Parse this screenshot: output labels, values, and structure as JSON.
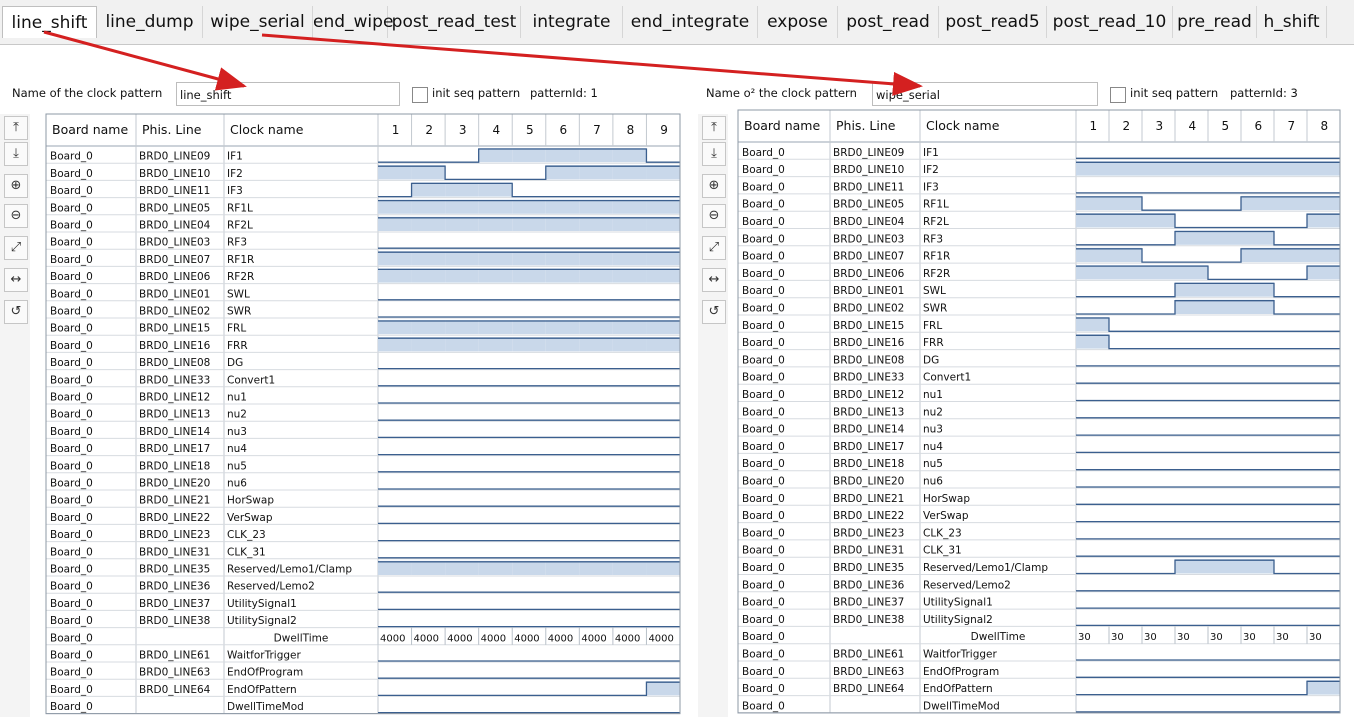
{
  "tabs": [
    "line_shift",
    "line_dump",
    "wipe_serial",
    "end_wipe",
    "post_read_test",
    "integrate",
    "end_integrate",
    "expose",
    "post_read",
    "post_read5",
    "post_read_10",
    "pre_read",
    "h_shift"
  ],
  "active_tab": "line_shift",
  "colors": {
    "high": "#c9d8ea",
    "edge": "#3b5f8e",
    "arrow": "#d42020",
    "grid": "#9aa6b3"
  },
  "toolbar_icons": [
    "add-row-icon",
    "remove-row-icon",
    "zoom-in-icon",
    "zoom-out-icon",
    "zoom-fit-icon",
    "zoom-width-icon",
    "zoom-reset-icon"
  ],
  "left_panel": {
    "name_label": "Name of the clock pattern",
    "name_value": "line_shift",
    "init_label": "init seq pattern",
    "pattern_id": "patternId: 1",
    "headers": [
      "Board name",
      "Phis. Line",
      "Clock name"
    ],
    "columns": [
      "1",
      "2",
      "3",
      "4",
      "5",
      "6",
      "7",
      "8",
      "9"
    ],
    "dwell_values": [
      "4000",
      "4000",
      "4000",
      "4000",
      "4000",
      "4000",
      "4000",
      "4000",
      "4000"
    ],
    "rows": [
      {
        "board": "Board_0",
        "line": "BRD0_LINE09",
        "clock": "IF1",
        "wave": [
          0,
          0,
          0,
          1,
          1,
          1,
          1,
          1,
          0
        ]
      },
      {
        "board": "Board_0",
        "line": "BRD0_LINE10",
        "clock": "IF2",
        "wave": [
          1,
          1,
          0,
          0,
          0,
          1,
          1,
          1,
          1
        ]
      },
      {
        "board": "Board_0",
        "line": "BRD0_LINE11",
        "clock": "IF3",
        "wave": [
          0,
          1,
          1,
          1,
          0,
          0,
          0,
          0,
          0
        ]
      },
      {
        "board": "Board_0",
        "line": "BRD0_LINE05",
        "clock": "RF1L",
        "wave": [
          1,
          1,
          1,
          1,
          1,
          1,
          1,
          1,
          1
        ]
      },
      {
        "board": "Board_0",
        "line": "BRD0_LINE04",
        "clock": "RF2L",
        "wave": [
          1,
          1,
          1,
          1,
          1,
          1,
          1,
          1,
          1
        ]
      },
      {
        "board": "Board_0",
        "line": "BRD0_LINE03",
        "clock": "RF3",
        "wave": [
          0,
          0,
          0,
          0,
          0,
          0,
          0,
          0,
          0
        ]
      },
      {
        "board": "Board_0",
        "line": "BRD0_LINE07",
        "clock": "RF1R",
        "wave": [
          1,
          1,
          1,
          1,
          1,
          1,
          1,
          1,
          1
        ]
      },
      {
        "board": "Board_0",
        "line": "BRD0_LINE06",
        "clock": "RF2R",
        "wave": [
          1,
          1,
          1,
          1,
          1,
          1,
          1,
          1,
          1
        ]
      },
      {
        "board": "Board_0",
        "line": "BRD0_LINE01",
        "clock": "SWL",
        "wave": [
          0,
          0,
          0,
          0,
          0,
          0,
          0,
          0,
          0
        ]
      },
      {
        "board": "Board_0",
        "line": "BRD0_LINE02",
        "clock": "SWR",
        "wave": [
          0,
          0,
          0,
          0,
          0,
          0,
          0,
          0,
          0
        ]
      },
      {
        "board": "Board_0",
        "line": "BRD0_LINE15",
        "clock": "FRL",
        "wave": [
          1,
          1,
          1,
          1,
          1,
          1,
          1,
          1,
          1
        ]
      },
      {
        "board": "Board_0",
        "line": "BRD0_LINE16",
        "clock": "FRR",
        "wave": [
          1,
          1,
          1,
          1,
          1,
          1,
          1,
          1,
          1
        ]
      },
      {
        "board": "Board_0",
        "line": "BRD0_LINE08",
        "clock": "DG",
        "wave": [
          0,
          0,
          0,
          0,
          0,
          0,
          0,
          0,
          0
        ]
      },
      {
        "board": "Board_0",
        "line": "BRD0_LINE33",
        "clock": "Convert1",
        "wave": [
          0,
          0,
          0,
          0,
          0,
          0,
          0,
          0,
          0
        ]
      },
      {
        "board": "Board_0",
        "line": "BRD0_LINE12",
        "clock": "nu1",
        "wave": [
          0,
          0,
          0,
          0,
          0,
          0,
          0,
          0,
          0
        ]
      },
      {
        "board": "Board_0",
        "line": "BRD0_LINE13",
        "clock": "nu2",
        "wave": [
          0,
          0,
          0,
          0,
          0,
          0,
          0,
          0,
          0
        ]
      },
      {
        "board": "Board_0",
        "line": "BRD0_LINE14",
        "clock": "nu3",
        "wave": [
          0,
          0,
          0,
          0,
          0,
          0,
          0,
          0,
          0
        ]
      },
      {
        "board": "Board_0",
        "line": "BRD0_LINE17",
        "clock": "nu4",
        "wave": [
          0,
          0,
          0,
          0,
          0,
          0,
          0,
          0,
          0
        ]
      },
      {
        "board": "Board_0",
        "line": "BRD0_LINE18",
        "clock": "nu5",
        "wave": [
          0,
          0,
          0,
          0,
          0,
          0,
          0,
          0,
          0
        ]
      },
      {
        "board": "Board_0",
        "line": "BRD0_LINE20",
        "clock": "nu6",
        "wave": [
          0,
          0,
          0,
          0,
          0,
          0,
          0,
          0,
          0
        ]
      },
      {
        "board": "Board_0",
        "line": "BRD0_LINE21",
        "clock": "HorSwap",
        "wave": [
          0,
          0,
          0,
          0,
          0,
          0,
          0,
          0,
          0
        ]
      },
      {
        "board": "Board_0",
        "line": "BRD0_LINE22",
        "clock": "VerSwap",
        "wave": [
          0,
          0,
          0,
          0,
          0,
          0,
          0,
          0,
          0
        ]
      },
      {
        "board": "Board_0",
        "line": "BRD0_LINE23",
        "clock": "CLK_23",
        "wave": [
          0,
          0,
          0,
          0,
          0,
          0,
          0,
          0,
          0
        ]
      },
      {
        "board": "Board_0",
        "line": "BRD0_LINE31",
        "clock": "CLK_31",
        "wave": [
          0,
          0,
          0,
          0,
          0,
          0,
          0,
          0,
          0
        ]
      },
      {
        "board": "Board_0",
        "line": "BRD0_LINE35",
        "clock": "Reserved/Lemo1/Clamp",
        "wave": [
          1,
          1,
          1,
          1,
          1,
          1,
          1,
          1,
          1
        ]
      },
      {
        "board": "Board_0",
        "line": "BRD0_LINE36",
        "clock": "Reserved/Lemo2",
        "wave": [
          0,
          0,
          0,
          0,
          0,
          0,
          0,
          0,
          0
        ]
      },
      {
        "board": "Board_0",
        "line": "BRD0_LINE37",
        "clock": "UtilitySignal1",
        "wave": [
          0,
          0,
          0,
          0,
          0,
          0,
          0,
          0,
          0
        ]
      },
      {
        "board": "Board_0",
        "line": "BRD0_LINE38",
        "clock": "UtilitySignal2",
        "wave": [
          0,
          0,
          0,
          0,
          0,
          0,
          0,
          0,
          0
        ]
      },
      {
        "board": "Board_0",
        "line": "",
        "clock": "DwellTime",
        "dwell": true
      },
      {
        "board": "Board_0",
        "line": "BRD0_LINE61",
        "clock": "WaitforTrigger",
        "wave": [
          0,
          0,
          0,
          0,
          0,
          0,
          0,
          0,
          0
        ]
      },
      {
        "board": "Board_0",
        "line": "BRD0_LINE63",
        "clock": "EndOfProgram",
        "wave": [
          0,
          0,
          0,
          0,
          0,
          0,
          0,
          0,
          0
        ]
      },
      {
        "board": "Board_0",
        "line": "BRD0_LINE64",
        "clock": "EndOfPattern",
        "wave": [
          0,
          0,
          0,
          0,
          0,
          0,
          0,
          0,
          1
        ]
      },
      {
        "board": "Board_0",
        "line": "",
        "clock": "DwellTimeMod",
        "wave": [
          0,
          0,
          0,
          0,
          0,
          0,
          0,
          0,
          0
        ]
      }
    ]
  },
  "right_panel": {
    "name_label": "Name o² the clock pattern",
    "name_value": "wipe_serial",
    "init_label": "init seq pattern",
    "pattern_id": "patternId: 3",
    "headers": [
      "Board name",
      "Phis. Line",
      "Clock name"
    ],
    "columns": [
      "1",
      "2",
      "3",
      "4",
      "5",
      "6",
      "7",
      "8"
    ],
    "dwell_values": [
      "30",
      "30",
      "30",
      "30",
      "30",
      "30",
      "30",
      "30"
    ],
    "rows": [
      {
        "board": "Board_0",
        "line": "BRD0_LINE09",
        "clock": "IF1",
        "wave": [
          0,
          0,
          0,
          0,
          0,
          0,
          0,
          0
        ]
      },
      {
        "board": "Board_0",
        "line": "BRD0_LINE10",
        "clock": "IF2",
        "wave": [
          1,
          1,
          1,
          1,
          1,
          1,
          1,
          1
        ]
      },
      {
        "board": "Board_0",
        "line": "BRD0_LINE11",
        "clock": "IF3",
        "wave": [
          0,
          0,
          0,
          0,
          0,
          0,
          0,
          0
        ]
      },
      {
        "board": "Board_0",
        "line": "BRD0_LINE05",
        "clock": "RF1L",
        "wave": [
          1,
          1,
          0,
          0,
          0,
          1,
          1,
          1
        ]
      },
      {
        "board": "Board_0",
        "line": "BRD0_LINE04",
        "clock": "RF2L",
        "wave": [
          1,
          1,
          1,
          0,
          0,
          0,
          0,
          1
        ]
      },
      {
        "board": "Board_0",
        "line": "BRD0_LINE03",
        "clock": "RF3",
        "wave": [
          0,
          0,
          0,
          1,
          1,
          1,
          0,
          0
        ]
      },
      {
        "board": "Board_0",
        "line": "BRD0_LINE07",
        "clock": "RF1R",
        "wave": [
          1,
          1,
          0,
          0,
          0,
          1,
          1,
          1
        ]
      },
      {
        "board": "Board_0",
        "line": "BRD0_LINE06",
        "clock": "RF2R",
        "wave": [
          1,
          1,
          1,
          1,
          0,
          0,
          0,
          1
        ]
      },
      {
        "board": "Board_0",
        "line": "BRD0_LINE01",
        "clock": "SWL",
        "wave": [
          0,
          0,
          0,
          1,
          1,
          1,
          0,
          0
        ]
      },
      {
        "board": "Board_0",
        "line": "BRD0_LINE02",
        "clock": "SWR",
        "wave": [
          0,
          0,
          0,
          1,
          1,
          1,
          0,
          0
        ]
      },
      {
        "board": "Board_0",
        "line": "BRD0_LINE15",
        "clock": "FRL",
        "wave": [
          1,
          0,
          0,
          0,
          0,
          0,
          0,
          0
        ]
      },
      {
        "board": "Board_0",
        "line": "BRD0_LINE16",
        "clock": "FRR",
        "wave": [
          1,
          0,
          0,
          0,
          0,
          0,
          0,
          0
        ]
      },
      {
        "board": "Board_0",
        "line": "BRD0_LINE08",
        "clock": "DG",
        "wave": [
          0,
          0,
          0,
          0,
          0,
          0,
          0,
          0
        ]
      },
      {
        "board": "Board_0",
        "line": "BRD0_LINE33",
        "clock": "Convert1",
        "wave": [
          0,
          0,
          0,
          0,
          0,
          0,
          0,
          0
        ]
      },
      {
        "board": "Board_0",
        "line": "BRD0_LINE12",
        "clock": "nu1",
        "wave": [
          0,
          0,
          0,
          0,
          0,
          0,
          0,
          0
        ]
      },
      {
        "board": "Board_0",
        "line": "BRD0_LINE13",
        "clock": "nu2",
        "wave": [
          0,
          0,
          0,
          0,
          0,
          0,
          0,
          0
        ]
      },
      {
        "board": "Board_0",
        "line": "BRD0_LINE14",
        "clock": "nu3",
        "wave": [
          0,
          0,
          0,
          0,
          0,
          0,
          0,
          0
        ]
      },
      {
        "board": "Board_0",
        "line": "BRD0_LINE17",
        "clock": "nu4",
        "wave": [
          0,
          0,
          0,
          0,
          0,
          0,
          0,
          0
        ]
      },
      {
        "board": "Board_0",
        "line": "BRD0_LINE18",
        "clock": "nu5",
        "wave": [
          0,
          0,
          0,
          0,
          0,
          0,
          0,
          0
        ]
      },
      {
        "board": "Board_0",
        "line": "BRD0_LINE20",
        "clock": "nu6",
        "wave": [
          0,
          0,
          0,
          0,
          0,
          0,
          0,
          0
        ]
      },
      {
        "board": "Board_0",
        "line": "BRD0_LINE21",
        "clock": "HorSwap",
        "wave": [
          0,
          0,
          0,
          0,
          0,
          0,
          0,
          0
        ]
      },
      {
        "board": "Board_0",
        "line": "BRD0_LINE22",
        "clock": "VerSwap",
        "wave": [
          0,
          0,
          0,
          0,
          0,
          0,
          0,
          0
        ]
      },
      {
        "board": "Board_0",
        "line": "BRD0_LINE23",
        "clock": "CLK_23",
        "wave": [
          0,
          0,
          0,
          0,
          0,
          0,
          0,
          0
        ]
      },
      {
        "board": "Board_0",
        "line": "BRD0_LINE31",
        "clock": "CLK_31",
        "wave": [
          0,
          0,
          0,
          0,
          0,
          0,
          0,
          0
        ]
      },
      {
        "board": "Board_0",
        "line": "BRD0_LINE35",
        "clock": "Reserved/Lemo1/Clamp",
        "wave": [
          0,
          0,
          0,
          1,
          1,
          1,
          0,
          0
        ]
      },
      {
        "board": "Board_0",
        "line": "BRD0_LINE36",
        "clock": "Reserved/Lemo2",
        "wave": [
          0,
          0,
          0,
          0,
          0,
          0,
          0,
          0
        ]
      },
      {
        "board": "Board_0",
        "line": "BRD0_LINE37",
        "clock": "UtilitySignal1",
        "wave": [
          0,
          0,
          0,
          0,
          0,
          0,
          0,
          0
        ]
      },
      {
        "board": "Board_0",
        "line": "BRD0_LINE38",
        "clock": "UtilitySignal2",
        "wave": [
          0,
          0,
          0,
          0,
          0,
          0,
          0,
          0
        ]
      },
      {
        "board": "Board_0",
        "line": "",
        "clock": "DwellTime",
        "dwell": true
      },
      {
        "board": "Board_0",
        "line": "BRD0_LINE61",
        "clock": "WaitforTrigger",
        "wave": [
          0,
          0,
          0,
          0,
          0,
          0,
          0,
          0
        ]
      },
      {
        "board": "Board_0",
        "line": "BRD0_LINE63",
        "clock": "EndOfProgram",
        "wave": [
          0,
          0,
          0,
          0,
          0,
          0,
          0,
          0
        ]
      },
      {
        "board": "Board_0",
        "line": "BRD0_LINE64",
        "clock": "EndOfPattern",
        "wave": [
          0,
          0,
          0,
          0,
          0,
          0,
          0,
          1
        ]
      },
      {
        "board": "Board_0",
        "line": "",
        "clock": "DwellTimeMod",
        "wave": [
          0,
          0,
          0,
          0,
          0,
          0,
          0,
          0
        ]
      }
    ]
  }
}
